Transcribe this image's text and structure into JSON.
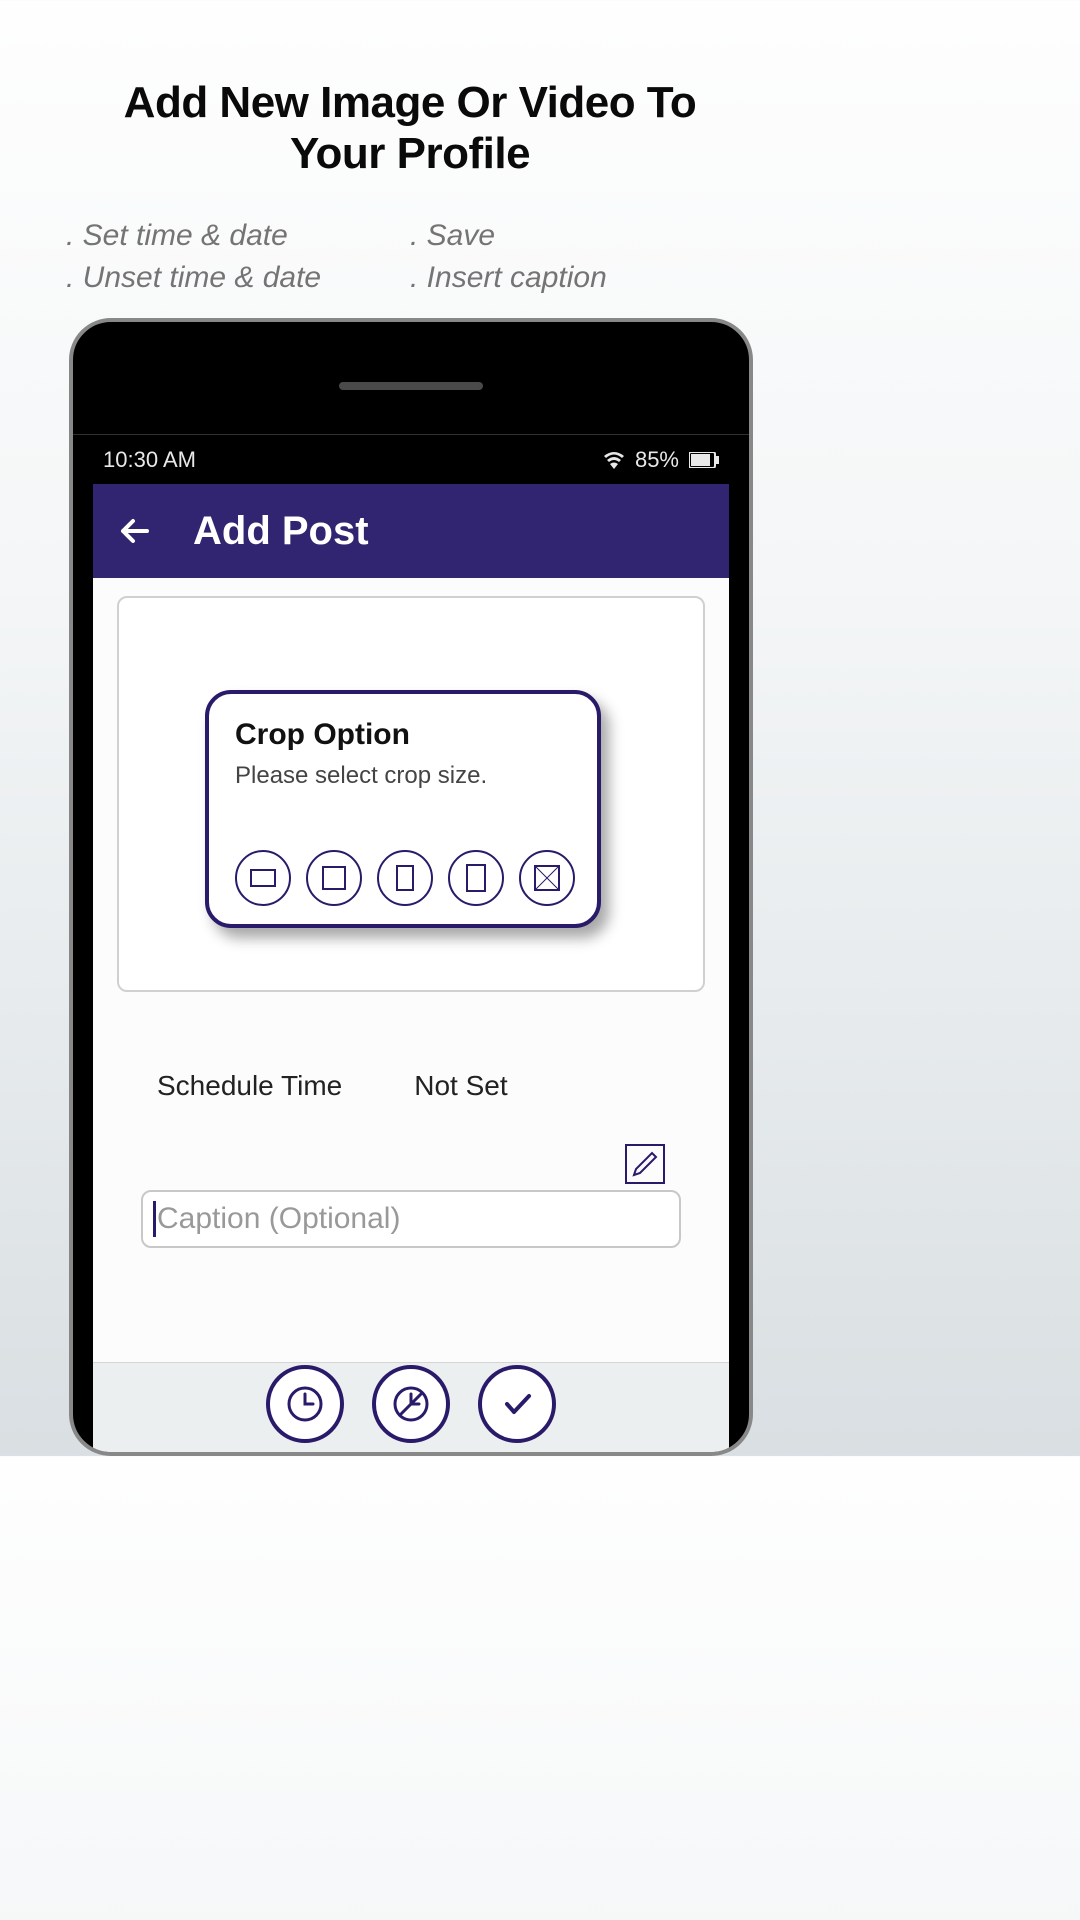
{
  "header": {
    "title_line1": "Add New Image Or Video To",
    "title_line2": "Your Profile"
  },
  "features": {
    "left": [
      ". Set time & date",
      ". Unset time & date"
    ],
    "right": [
      ". Save",
      ". Insert caption"
    ]
  },
  "status": {
    "time": "10:30 AM",
    "battery": "85%"
  },
  "app_bar": {
    "title": "Add Post"
  },
  "crop_dialog": {
    "title": "Crop Option",
    "subtitle": "Please select crop size."
  },
  "schedule": {
    "label": "Schedule Time",
    "value": "Not Set"
  },
  "caption": {
    "placeholder": "Caption (Optional)",
    "value": ""
  },
  "icons": {
    "back": "back-arrow",
    "edit": "edit-pencil",
    "clock": "clock",
    "no_clock": "clock-disabled",
    "check": "checkmark"
  }
}
